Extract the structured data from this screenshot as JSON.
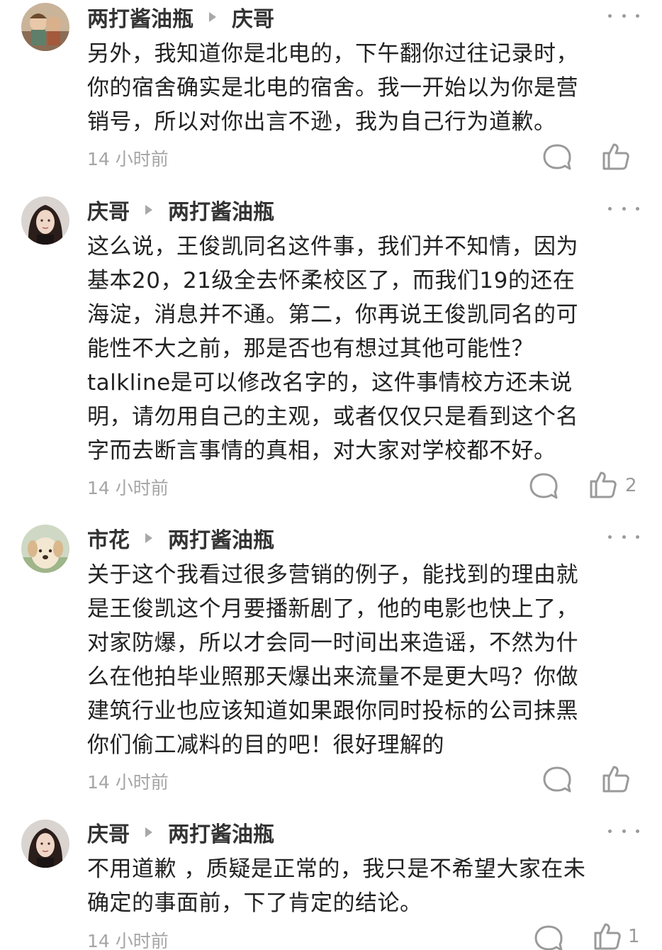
{
  "comments": [
    {
      "author": "两打酱油瓶",
      "reply_to": "庆哥",
      "avatar": "illustration-avatar",
      "lines": [
        "另外，我知道你是北电的，下午翻你过往记录时，",
        "你的宿舍确实是北电的宿舍。我一开始以为你是营",
        "销号，所以对你出言不逊，我为自己行为道歉。"
      ],
      "time": "14 小时前",
      "like_count": ""
    },
    {
      "author": "庆哥",
      "reply_to": "两打酱油瓶",
      "avatar": "woman-portrait-avatar",
      "lines": [
        "这么说，王俊凯同名这件事，我们并不知情，因为",
        "基本20，21级全去怀柔校区了，而我们19的还在",
        "海淀，消息并不通。第二，你再说王俊凯同名的可",
        "能性不大之前，那是否也有想过其他可能性？",
        "talkline是可以修改名字的，这件事情校方还未说",
        "明，请勿用自己的主观，或者仅仅只是看到这个名",
        "字而去断言事情的真相，对大家对学校都不好。"
      ],
      "time": "14 小时前",
      "like_count": "2"
    },
    {
      "author": "市花",
      "reply_to": "两打酱油瓶",
      "avatar": "puppy-avatar",
      "lines": [
        "关于这个我看过很多营销的例子，能找到的理由就",
        "是王俊凯这个月要播新剧了，他的电影也快上了，",
        "对家防爆，所以才会同一时间出来造谣，不然为什",
        "么在他拍毕业照那天爆出来流量不是更大吗？你做",
        "建筑行业也应该知道如果跟你同时投标的公司抹黑",
        "你们偷工减料的目的吧！很好理解的"
      ],
      "time": "14 小时前",
      "like_count": ""
    },
    {
      "author": "庆哥",
      "reply_to": "两打酱油瓶",
      "avatar": "woman-portrait-avatar",
      "lines": [
        "不用道歉 ，质疑是正常的，我只是不希望大家在未",
        "确定的事面前，下了肯定的结论。"
      ],
      "time": "14 小时前",
      "like_count": "1"
    }
  ],
  "colors": {
    "text": "#222222",
    "name": "#333333",
    "meta": "#a5a5a5",
    "icon": "#9a9a9a"
  }
}
